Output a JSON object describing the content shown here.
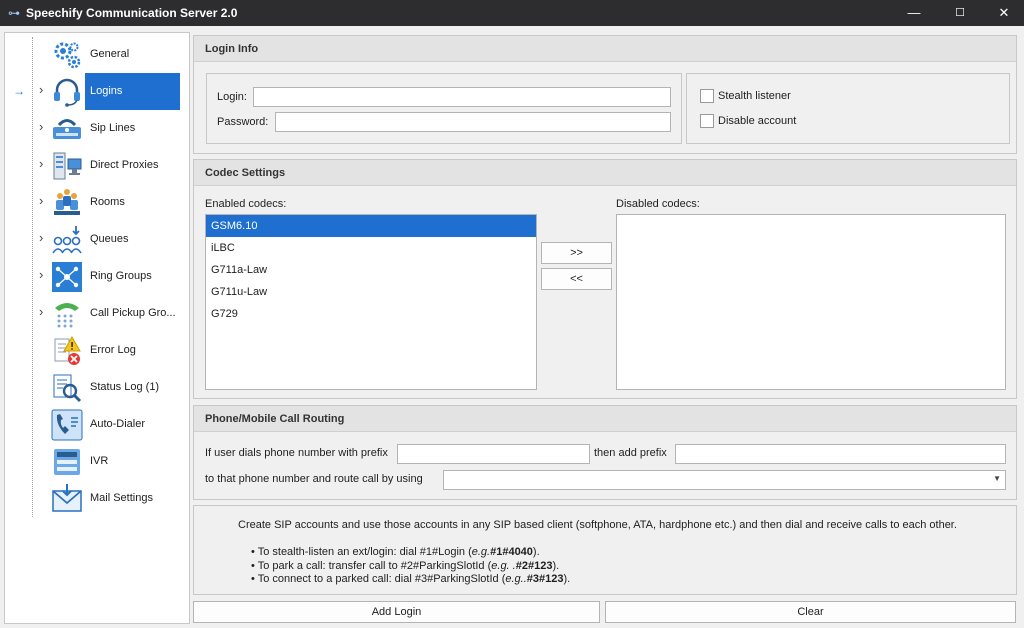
{
  "window": {
    "title": "Speechify Communication Server 2.0",
    "minimize": "—",
    "maximize": "☐",
    "close": "✕"
  },
  "nav": {
    "selected_pointer": "→",
    "items": [
      {
        "label": "General",
        "icon": "gears-icon",
        "expandable": false
      },
      {
        "label": "Logins",
        "icon": "headset-icon",
        "expandable": true,
        "selected": true
      },
      {
        "label": "Sip Lines",
        "icon": "phone-line-icon",
        "expandable": true
      },
      {
        "label": "Direct Proxies",
        "icon": "proxy-servers-icon",
        "expandable": true
      },
      {
        "label": "Rooms",
        "icon": "rooms-icon",
        "expandable": true
      },
      {
        "label": "Queues",
        "icon": "queues-icon",
        "expandable": true
      },
      {
        "label": "Ring Groups",
        "icon": "ring-groups-icon",
        "expandable": true
      },
      {
        "label": "Call Pickup Gro...",
        "icon": "call-pickup-icon",
        "expandable": true
      },
      {
        "label": "Error Log",
        "icon": "error-log-icon",
        "expandable": false
      },
      {
        "label": "Status Log (1)",
        "icon": "status-log-icon",
        "expandable": false
      },
      {
        "label": "Auto-Dialer",
        "icon": "auto-dialer-icon",
        "expandable": false
      },
      {
        "label": "IVR",
        "icon": "ivr-icon",
        "expandable": false
      },
      {
        "label": "Mail Settings",
        "icon": "mail-icon",
        "expandable": false
      }
    ]
  },
  "login_info": {
    "header": "Login Info",
    "login_label": "Login:",
    "login_value": "",
    "password_label": "Password:",
    "password_value": "",
    "stealth_label": "Stealth listener",
    "stealth_checked": false,
    "disable_label": "Disable account",
    "disable_checked": false
  },
  "codec": {
    "header": "Codec Settings",
    "enabled_label": "Enabled codecs:",
    "disabled_label": "Disabled codecs:",
    "enabled": [
      "GSM6.10",
      "iLBC",
      "G711a-Law",
      "G711u-Law",
      "G729"
    ],
    "selected_index": 0,
    "disabled": [],
    "move_right": ">>",
    "move_left": "<<"
  },
  "routing": {
    "header": "Phone/Mobile Call Routing",
    "prefix_label": "If user dials phone number with prefix",
    "prefix_value": "",
    "add_prefix_label": "then add prefix",
    "add_prefix_value": "",
    "route_label": "to that phone number and route call by using",
    "route_value": ""
  },
  "info": {
    "intro": "Create SIP accounts and use those accounts in any SIP based client (softphone, ATA, hardphone etc.) and then dial and receive calls to each other.",
    "bullet1_text": "• To stealth-listen an ext/login: dial #1#Login (",
    "bullet1_eg": "e.g.",
    "bullet1_example": "#1#4040",
    "bullet1_end": ").",
    "bullet2_text": "• To park a call: transfer call to #2#ParkingSlotId (",
    "bullet2_eg": "e.g. .",
    "bullet2_example": "#2#123",
    "bullet2_end": ").",
    "bullet3_text": "• To connect to a parked call: dial #3#ParkingSlotId (",
    "bullet3_eg": "e.g..",
    "bullet3_example": "#3#123",
    "bullet3_end": ")."
  },
  "buttons": {
    "add_login": "Add Login",
    "clear": "Clear"
  },
  "colors": {
    "titlebar": "#2d2d30",
    "selection": "#1e6fd0"
  }
}
